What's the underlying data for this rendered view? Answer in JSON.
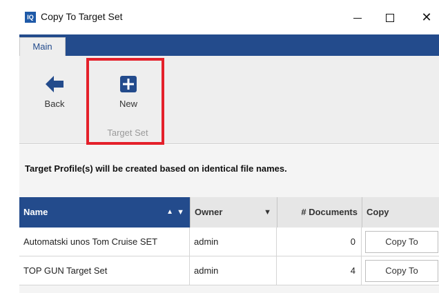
{
  "window": {
    "title": "Copy To Target Set",
    "icon_text": "IQ"
  },
  "ribbon": {
    "tabs": [
      {
        "label": "Main"
      }
    ],
    "back_label": "Back",
    "new_label": "New",
    "group_label": "Target Set"
  },
  "notice": "Target Profile(s) will be created based on identical file names.",
  "table": {
    "columns": [
      "Name",
      "Owner",
      "# Documents",
      "Copy"
    ],
    "rows": [
      {
        "name": "Automatski unos Tom Cruise SET",
        "owner": "admin",
        "documents": "0",
        "action": "Copy To"
      },
      {
        "name": "TOP GUN Target Set",
        "owner": "admin",
        "documents": "4",
        "action": "Copy To"
      }
    ]
  },
  "colors": {
    "accent": "#234b8c",
    "highlight": "#e4202a"
  }
}
